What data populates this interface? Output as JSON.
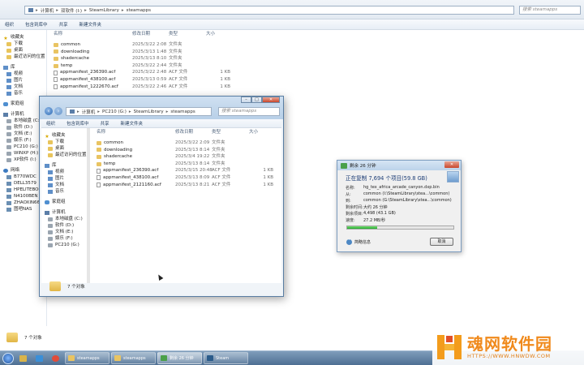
{
  "back_window": {
    "breadcrumb": [
      "计算机",
      "双软件 (I:)",
      "SteamLibrary",
      "steamapps"
    ],
    "search_placeholder": "搜索 steamapps",
    "toolbar": [
      "组织",
      "包含到库中",
      "共享",
      "新建文件夹"
    ],
    "columns": [
      "名称",
      "修改日期",
      "类型",
      "大小"
    ],
    "files": [
      {
        "name": "common",
        "date": "2025/3/22 2:08",
        "type": "文件夹",
        "size": "",
        "kind": "folder"
      },
      {
        "name": "downloading",
        "date": "2025/3/13 1:48",
        "type": "文件夹",
        "size": "",
        "kind": "folder"
      },
      {
        "name": "shadercache",
        "date": "2025/3/13 8:10",
        "type": "文件夹",
        "size": "",
        "kind": "folder"
      },
      {
        "name": "temp",
        "date": "2025/3/22 2:44",
        "type": "文件夹",
        "size": "",
        "kind": "folder"
      },
      {
        "name": "appmanifest_236390.acf",
        "date": "2025/3/22 2:48",
        "type": "ACF 文件",
        "size": "1 KB",
        "kind": "file"
      },
      {
        "name": "appmanifest_438100.acf",
        "date": "2025/3/13 0:59",
        "type": "ACF 文件",
        "size": "1 KB",
        "kind": "file"
      },
      {
        "name": "appmanifest_1222670.acf",
        "date": "2025/3/22 2:46",
        "type": "ACF 文件",
        "size": "1 KB",
        "kind": "file"
      }
    ],
    "sidebar": [
      {
        "label": "收藏夹",
        "icon": "star-icon",
        "head": true
      },
      {
        "label": "下载",
        "icon": "folder-icon"
      },
      {
        "label": "桌面",
        "icon": "folder-icon"
      },
      {
        "label": "最近访问的位置",
        "icon": "folder-icon"
      },
      {
        "label": "库",
        "icon": "library-icon",
        "head": true
      },
      {
        "label": "视频",
        "icon": "library-icon"
      },
      {
        "label": "图片",
        "icon": "library-icon"
      },
      {
        "label": "文档",
        "icon": "library-icon"
      },
      {
        "label": "音乐",
        "icon": "library-icon"
      },
      {
        "label": "家庭组",
        "icon": "homegroup-icon",
        "head": true
      },
      {
        "label": "计算机",
        "icon": "computer-icon",
        "head": true
      },
      {
        "label": "本地磁盘 (C:)",
        "icon": "drive-icon"
      },
      {
        "label": "软件 (D:)",
        "icon": "drive-icon"
      },
      {
        "label": "文档 (E:)",
        "icon": "drive-icon"
      },
      {
        "label": "娱乐 (F:)",
        "icon": "drive-icon"
      },
      {
        "label": "PC210 (G:)",
        "icon": "drive-icon"
      },
      {
        "label": "WINXP (H:)",
        "icon": "drive-icon"
      },
      {
        "label": "XP软件 (I:)",
        "icon": "drive-icon"
      },
      {
        "label": "网络",
        "icon": "network-icon",
        "head": true
      },
      {
        "label": "B770WDC",
        "icon": "pc-icon"
      },
      {
        "label": "DELL3579",
        "icon": "pc-icon"
      },
      {
        "label": "HPELITEBOOK",
        "icon": "pc-icon"
      },
      {
        "label": "N4100BEN",
        "icon": "pc-icon"
      },
      {
        "label": "ZHAOXIN6640",
        "icon": "pc-icon"
      },
      {
        "label": "图吧NAS",
        "icon": "pc-icon"
      }
    ],
    "status": "7 个对象"
  },
  "front_window": {
    "breadcrumb": [
      "计算机",
      "PC210 (G:)",
      "SteamLibrary",
      "steamapps"
    ],
    "search_placeholder": "搜索 steamapps",
    "toolbar": [
      "组织",
      "包含到库中",
      "共享",
      "新建文件夹"
    ],
    "columns": [
      "名称",
      "修改日期",
      "类型",
      "大小"
    ],
    "files": [
      {
        "name": "common",
        "date": "2025/3/22 2:09",
        "type": "文件夹",
        "size": "",
        "kind": "folder"
      },
      {
        "name": "downloading",
        "date": "2025/3/13 8:14",
        "type": "文件夹",
        "size": "",
        "kind": "folder"
      },
      {
        "name": "shadercache",
        "date": "2025/3/4 19:22",
        "type": "文件夹",
        "size": "",
        "kind": "folder"
      },
      {
        "name": "temp",
        "date": "2025/3/13 8:14",
        "type": "文件夹",
        "size": "",
        "kind": "folder"
      },
      {
        "name": "appmanifest_236390.acf",
        "date": "2025/3/15 20:48",
        "type": "ACF 文件",
        "size": "1 KB",
        "kind": "file"
      },
      {
        "name": "appmanifest_438100.acf",
        "date": "2025/3/13 8:09",
        "type": "ACF 文件",
        "size": "1 KB",
        "kind": "file"
      },
      {
        "name": "appmanifest_2121160.acf",
        "date": "2025/3/13 8:21",
        "type": "ACF 文件",
        "size": "1 KB",
        "kind": "file"
      }
    ],
    "sidebar": [
      {
        "label": "收藏夹",
        "icon": "star-icon",
        "head": true
      },
      {
        "label": "下载",
        "icon": "folder-icon"
      },
      {
        "label": "桌面",
        "icon": "folder-icon"
      },
      {
        "label": "最近访问的位置",
        "icon": "folder-icon"
      },
      {
        "label": "库",
        "icon": "library-icon",
        "head": true
      },
      {
        "label": "视频",
        "icon": "library-icon"
      },
      {
        "label": "图片",
        "icon": "library-icon"
      },
      {
        "label": "文档",
        "icon": "library-icon"
      },
      {
        "label": "音乐",
        "icon": "library-icon"
      },
      {
        "label": "家庭组",
        "icon": "homegroup-icon",
        "head": true
      },
      {
        "label": "计算机",
        "icon": "computer-icon",
        "head": true
      },
      {
        "label": "本地磁盘 (C:)",
        "icon": "drive-icon"
      },
      {
        "label": "软件 (D:)",
        "icon": "drive-icon"
      },
      {
        "label": "文档 (E:)",
        "icon": "drive-icon"
      },
      {
        "label": "娱乐 (F:)",
        "icon": "drive-icon"
      },
      {
        "label": "PC210 (G:)",
        "icon": "drive-icon"
      }
    ],
    "status": "7 个对象"
  },
  "copy_dialog": {
    "title": "剩余 26 分钟",
    "headline": "正在复制 7,694 个项目(59.8 GB)",
    "rows": [
      {
        "label": "名称:",
        "value": "hg_tex_africa_arcade_canyon.dxp.bin"
      },
      {
        "label": "从:",
        "value": "common (I:\\SteamLibrary\\stea...\\common)",
        "bold": "common"
      },
      {
        "label": "到:",
        "value": "common (G:\\SteamLibrary\\stea...\\common)",
        "bold": "common"
      },
      {
        "label": "剩余时间:",
        "value": "大约 26 分钟"
      },
      {
        "label": "剩余项目:",
        "value": "4,498 (43.1 GB)"
      },
      {
        "label": "速度:",
        "value": "27.2 MB/秒"
      }
    ],
    "progress_fraction": 0.28,
    "less_label": "简略信息",
    "cancel_label": "取消"
  },
  "taskbar": {
    "tasks": [
      {
        "label": "steamapps",
        "icon": "folder-icon",
        "active": false
      },
      {
        "label": "steamapps",
        "icon": "folder-icon",
        "active": false
      },
      {
        "label": "剩余 26 分钟",
        "icon": "copy-icon",
        "active": true
      },
      {
        "label": "Steam",
        "icon": "steam-icon",
        "active": false
      }
    ]
  },
  "watermark": {
    "main": "魂网软件园",
    "url": "HTTPS://WWW.HNWDW.COM"
  },
  "colors": {
    "folder": "#e9c462",
    "accent": "#1b3c75",
    "progress": "#1fa82a"
  }
}
